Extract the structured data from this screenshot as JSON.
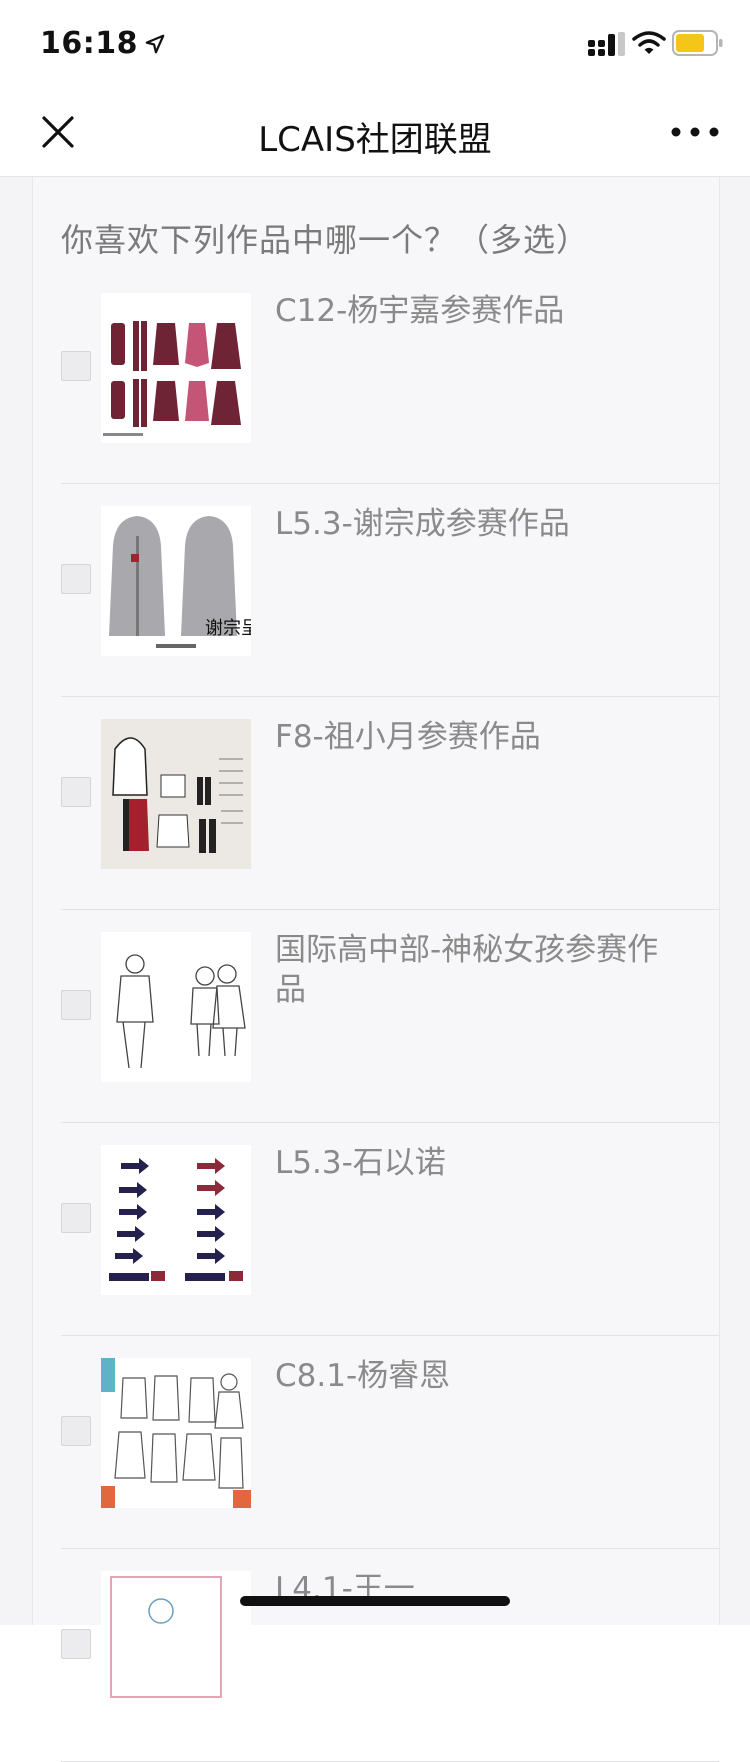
{
  "status": {
    "time": "16:18",
    "icons": [
      "location-arrow-icon",
      "signal-icon",
      "wifi-icon",
      "battery-icon"
    ],
    "battery_color": "#f5c518"
  },
  "nav": {
    "title": "LCAIS社团联盟",
    "icons": [
      "close-icon",
      "more-icon"
    ]
  },
  "form": {
    "question": "你喜欢下列作品中哪一个？（多选）",
    "options": [
      {
        "label": "C12-杨宇嘉参赛作品",
        "checked": false,
        "thumb": "maroon-garment-sketches"
      },
      {
        "label": "L5.3-谢宗成参赛作品",
        "checked": false,
        "thumb": "grey-hoodie-sketch",
        "thumb_text": "谢宗呈"
      },
      {
        "label": "F8-祖小月参赛作品",
        "checked": false,
        "thumb": "red-black-outfit-sketch"
      },
      {
        "label": "国际高中部-神秘女孩参赛作品",
        "checked": false,
        "thumb": "pencil-figure-sketch"
      },
      {
        "label": "L5.3-石以诺",
        "checked": false,
        "thumb": "arrow-garment-sketches"
      },
      {
        "label": "C8.1-杨睿恩",
        "checked": false,
        "thumb": "line-fashion-sketch"
      },
      {
        "label": "L4.1-王一",
        "checked": false,
        "thumb": "partial-sketch"
      }
    ]
  },
  "colors": {
    "background": "#f4f4f6",
    "card": "#f7f7f9",
    "label_text": "#8a8a8a",
    "question_text": "#7a7a7a"
  }
}
